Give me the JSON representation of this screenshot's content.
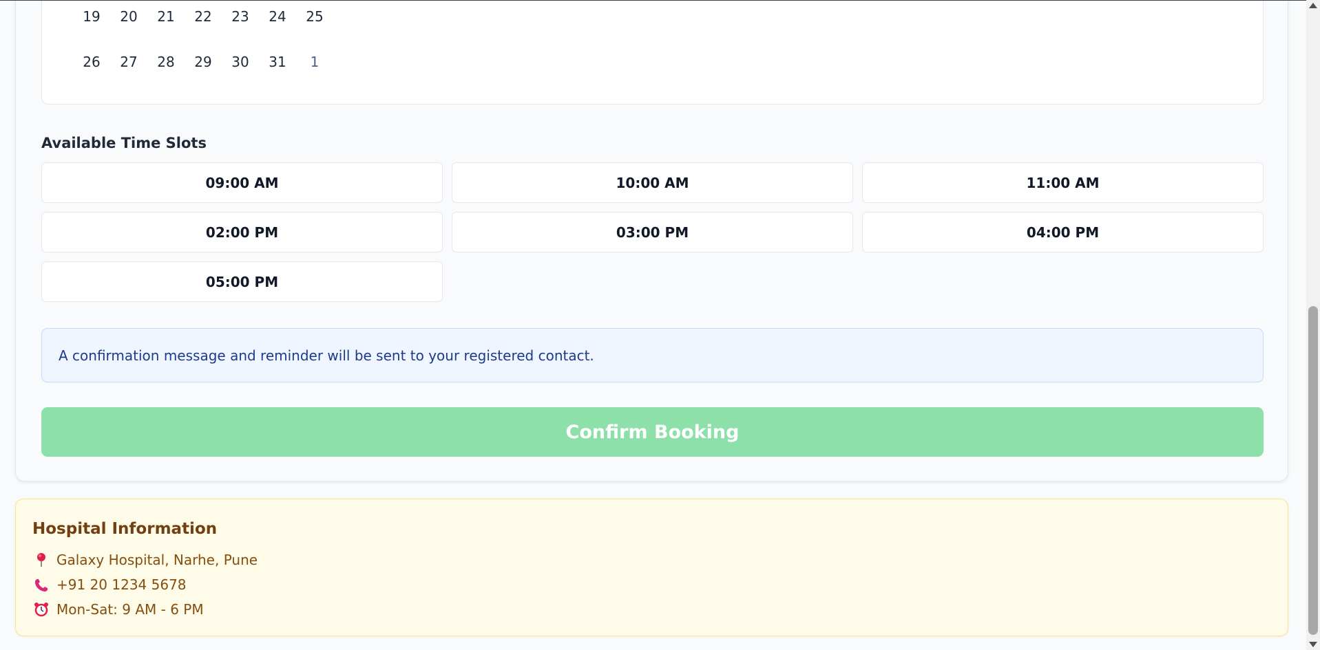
{
  "calendar": {
    "rows": [
      [
        "19",
        "20",
        "21",
        "22",
        "23",
        "24",
        "25"
      ],
      [
        "26",
        "27",
        "28",
        "29",
        "30",
        "31",
        "1"
      ]
    ]
  },
  "time_slots": {
    "title": "Available Time Slots",
    "slots": [
      "09:00 AM",
      "10:00 AM",
      "11:00 AM",
      "02:00 PM",
      "03:00 PM",
      "04:00 PM",
      "05:00 PM"
    ]
  },
  "notice": {
    "text": "A confirmation message and reminder will be sent to your registered contact."
  },
  "confirm_button": {
    "label": "Confirm Booking",
    "color": "#8ee0ab"
  },
  "hospital": {
    "title": "Hospital Information",
    "address": "Galaxy Hospital, Narhe, Pune",
    "address_icon": "pin-icon",
    "phone": "+91 20 1234 5678",
    "phone_icon": "phone-icon",
    "hours": "Mon-Sat: 9 AM - 6 PM",
    "hours_icon": "alarm-clock-icon"
  }
}
